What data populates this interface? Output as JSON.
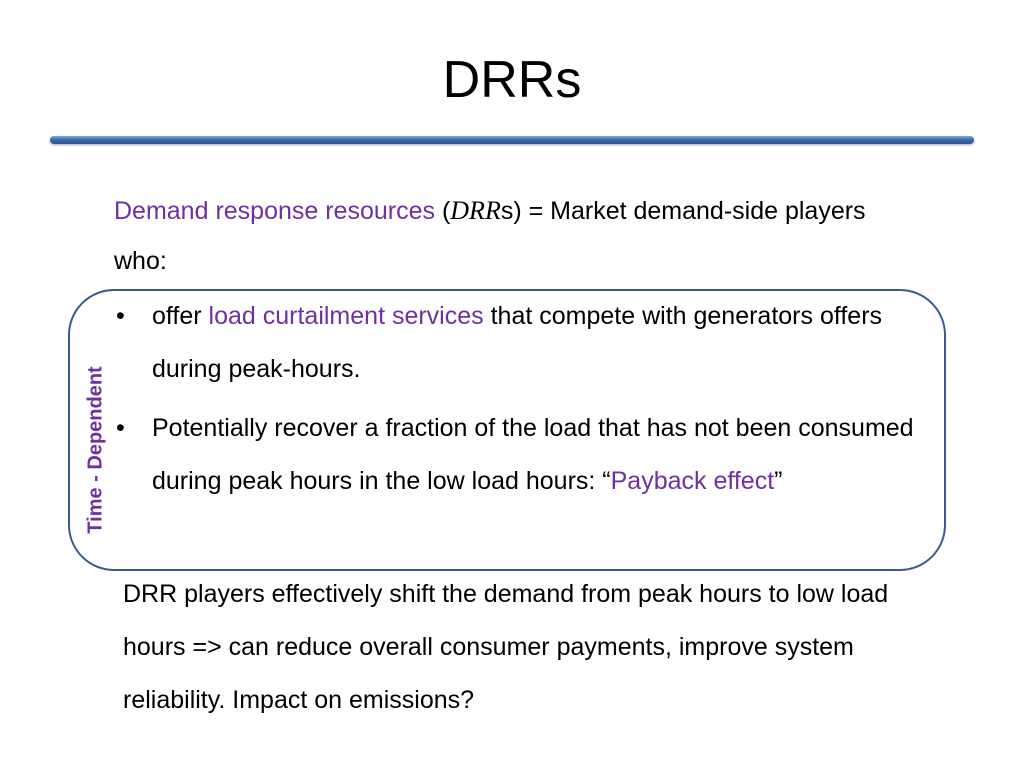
{
  "slide": {
    "title": "DRRs",
    "intro": {
      "term": "Demand response resources",
      "paren_open": " (",
      "abbr_italic": "DRR",
      "abbr_rest": "s) = Market demand-side players who:"
    },
    "side_label": "Time - Dependent",
    "bullets": [
      {
        "marker": "•",
        "pre": "offer ",
        "highlight": "load curtailment services",
        "post": " that compete with generators offers during peak-hours."
      },
      {
        "marker": "•",
        "pre": "Potentially recover a fraction of the load that has not been consumed during peak hours in the low load hours: “",
        "highlight": "Payback effect",
        "post": "”"
      }
    ],
    "outro": "DRR players effectively shift the demand from peak hours to low load hours => can reduce overall consumer payments, improve system reliability. Impact on emissions?",
    "colors": {
      "highlight": "#7030a0",
      "divider": "#3d6cae",
      "box_border": "#3a5a8c"
    }
  }
}
